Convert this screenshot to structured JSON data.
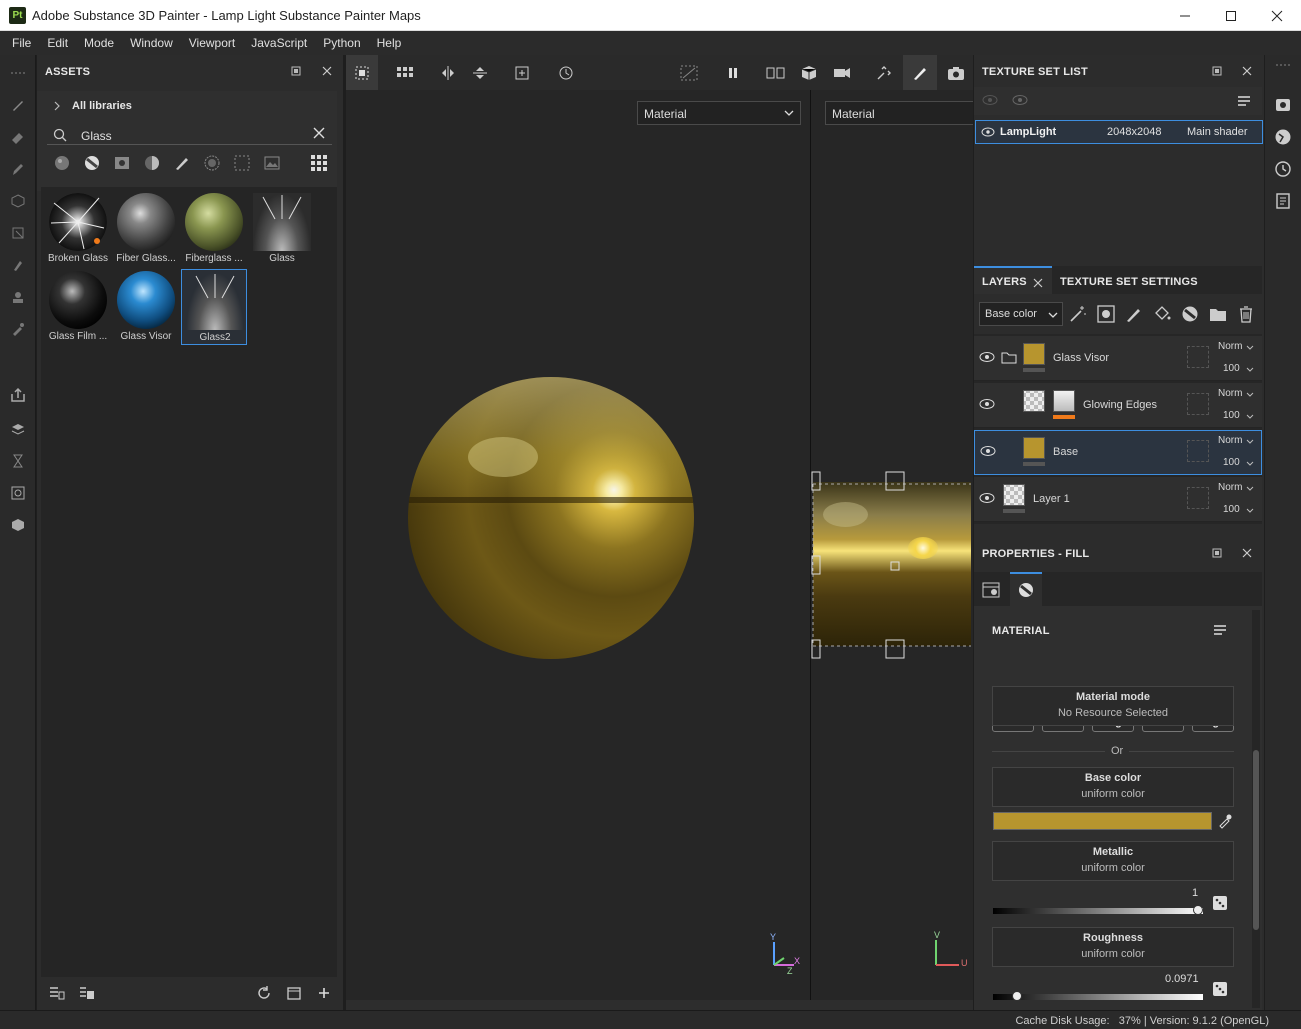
{
  "window": {
    "app_badge": "Pt",
    "title": "Adobe Substance 3D Painter - Lamp Light Substance Painter Maps"
  },
  "menu": [
    "File",
    "Edit",
    "Mode",
    "Window",
    "Viewport",
    "JavaScript",
    "Python",
    "Help"
  ],
  "assets": {
    "title": "ASSETS",
    "breadcrumb": "All libraries",
    "search_value": "Glass",
    "items": [
      {
        "label": "Broken Glass",
        "icon": "broken-glass-thumb"
      },
      {
        "label": "Fiber Glass...",
        "icon": "fiber-glass-thumb"
      },
      {
        "label": "Fiberglass ...",
        "icon": "fiberglass-thumb"
      },
      {
        "label": "Glass",
        "icon": "glass-light-thumb"
      },
      {
        "label": "Glass Film ...",
        "icon": "glass-film-thumb"
      },
      {
        "label": "Glass Visor",
        "icon": "glass-visor-thumb"
      },
      {
        "label": "Glass2",
        "icon": "glass-light-thumb",
        "selected": true
      }
    ]
  },
  "viewport": {
    "dropdown_3d": "Material",
    "dropdown_2d": "Material",
    "axis_3d": {
      "y": "Y",
      "x": "X",
      "z": "Z"
    },
    "axis_2d": {
      "v": "V",
      "u": "U"
    }
  },
  "texture_set_list": {
    "title": "TEXTURE SET LIST",
    "row": {
      "name": "LampLight",
      "resolution": "2048x2048",
      "shader": "Main shader"
    }
  },
  "layers": {
    "tab_active": "LAYERS",
    "tab_other": "TEXTURE SET SETTINGS",
    "channel": "Base color",
    "rows": [
      {
        "name": "Glass Visor",
        "blend": "Norm",
        "opacity": "100"
      },
      {
        "name": "Glowing Edges",
        "blend": "Norm",
        "opacity": "100"
      },
      {
        "name": "Base",
        "blend": "Norm",
        "opacity": "100",
        "selected": true
      },
      {
        "name": "Layer 1",
        "blend": "Norm",
        "opacity": "100"
      }
    ]
  },
  "properties": {
    "title": "PROPERTIES - FILL",
    "section": "MATERIAL",
    "channels": [
      "color",
      "metal",
      "rough",
      "nrm",
      "height"
    ],
    "material_mode": {
      "title": "Material mode",
      "sub": "No Resource Selected"
    },
    "or_label": "Or",
    "base_color": {
      "title": "Base color",
      "sub": "uniform color",
      "swatch": "#b7952e"
    },
    "metallic": {
      "title": "Metallic",
      "sub": "uniform color",
      "value": "1",
      "fraction": 1.0
    },
    "roughness": {
      "title": "Roughness",
      "sub": "uniform color",
      "value": "0.0971",
      "fraction": 0.0971
    }
  },
  "status": {
    "text": "Cache Disk Usage:   37% | Version: 9.1.2 (OpenGL)"
  },
  "colors": {
    "accent": "#3d8ee0",
    "gold": "#b7952e",
    "panel": "#2c2c2c",
    "orange": "#f07a1a"
  }
}
